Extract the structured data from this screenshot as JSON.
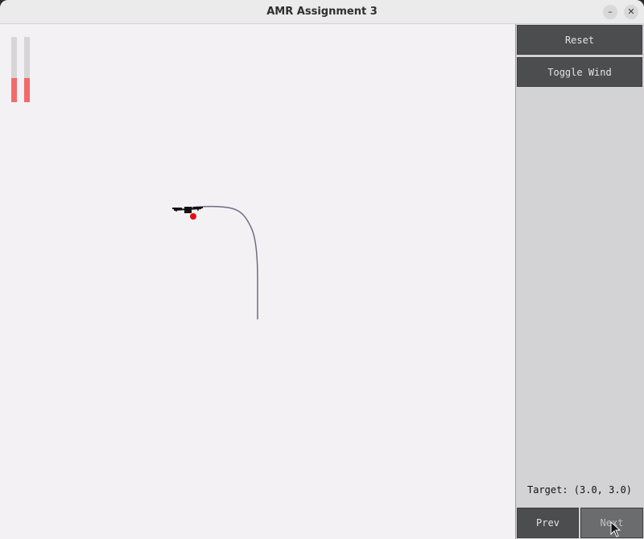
{
  "window": {
    "title": "AMR Assignment 3",
    "minimize_glyph": "–",
    "close_glyph": "✕"
  },
  "indicators": {
    "bars": [
      {
        "name": "left-thrust",
        "level": 0.37,
        "color": "#f26a6a"
      },
      {
        "name": "right-thrust",
        "level": 0.37,
        "color": "#f26a6a"
      }
    ]
  },
  "sidebar": {
    "reset_label": "Reset",
    "toggle_wind_label": "Toggle Wind",
    "target_label": "Target: (3.0, 3.0)",
    "prev_label": "Prev",
    "next_label": "Next"
  },
  "colors": {
    "trajectory": "#6e6e86",
    "target": "#e01010",
    "drone": "#111111",
    "button": "#4b4d4f"
  },
  "icons": [
    "minimize-icon",
    "close-icon",
    "drone-icon",
    "target-marker-icon",
    "mouse-cursor-icon"
  ]
}
